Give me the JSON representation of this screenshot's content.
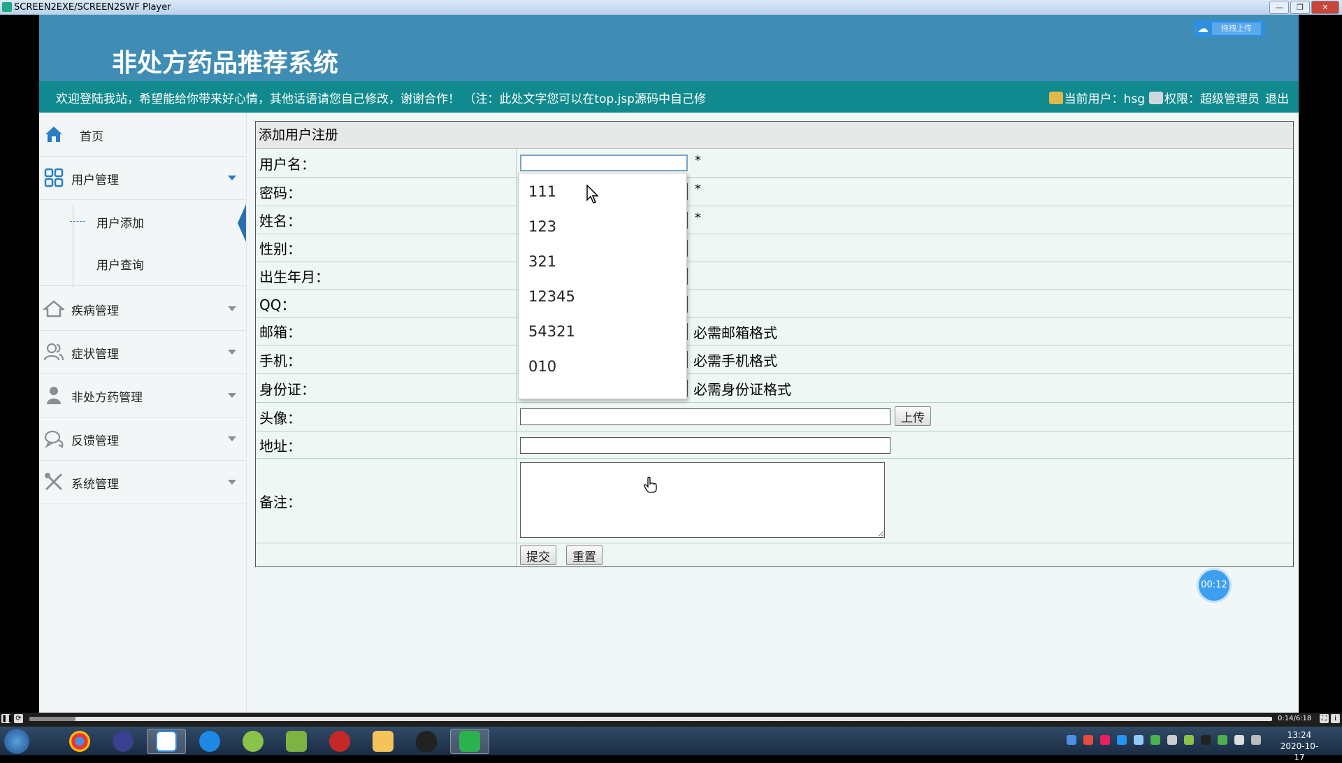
{
  "window": {
    "title": "SCREEN2EXE/SCREEN2SWF Player",
    "buttons": {
      "minimize": "—",
      "maximize": "❐",
      "close": "✕"
    }
  },
  "header": {
    "system_title": "非处方药品推荐系统",
    "drag_upload_label": "拖拽上传",
    "welcome_text": "欢迎登陆我站，希望能给你带来好心情，其他话语请您自己修改，谢谢合作！ （注：此处文字您可以在top.jsp源码中自己修",
    "current_user_text": "当前用户：hsg",
    "permission_text": "权限：超级管理员",
    "logout_label": "退出"
  },
  "sidebar": {
    "home_label": "首页",
    "user_mgmt_label": "用户管理",
    "user_add_label": "用户添加",
    "user_query_label": "用户查询",
    "items": [
      {
        "label": "疾病管理",
        "icon": "home-roof-icon"
      },
      {
        "label": "症状管理",
        "icon": "users-icon"
      },
      {
        "label": "非处方药管理",
        "icon": "person-icon"
      },
      {
        "label": "反馈管理",
        "icon": "chat-icon"
      },
      {
        "label": "系统管理",
        "icon": "tools-icon"
      }
    ]
  },
  "form": {
    "title": "添加用户注册",
    "rows": {
      "username": {
        "label": "用户名：",
        "req": "*"
      },
      "password": {
        "label": "密码：",
        "req": "*"
      },
      "name": {
        "label": "姓名：",
        "req": "*"
      },
      "gender": {
        "label": "性别："
      },
      "birth": {
        "label": "出生年月："
      },
      "qq": {
        "label": "QQ："
      },
      "email": {
        "label": "邮箱：",
        "hint": "必需邮箱格式"
      },
      "phone": {
        "label": "手机：",
        "hint": "必需手机格式"
      },
      "idcard": {
        "label": "身份证：",
        "hint": "必需身份证格式"
      },
      "avatar": {
        "label": "头像：",
        "upload_label": "上传"
      },
      "address": {
        "label": "地址："
      },
      "remark": {
        "label": "备注："
      }
    },
    "submit_label": "提交",
    "reset_label": "重置"
  },
  "autocomplete": [
    "111",
    "123",
    "321",
    "12345",
    "54321",
    "010"
  ],
  "recorder": {
    "timer": "00:12",
    "time_text": "0:14/6:18",
    "progress": 0.037
  },
  "taskbar": {
    "time": "13:24",
    "date": "2020-10-17",
    "apps": [
      "chrome-icon",
      "media-player-icon",
      "baidu-netdisk-icon",
      "browser-icon",
      "green-app-icon",
      "chart-app-icon",
      "flash-icon",
      "folder-icon",
      "qq-icon",
      "screen-recorder-icon"
    ]
  },
  "colors": {
    "header_blue": "#3f8db4",
    "welcome_teal": "#108a8e",
    "accent_blue": "#2a7ec3"
  }
}
